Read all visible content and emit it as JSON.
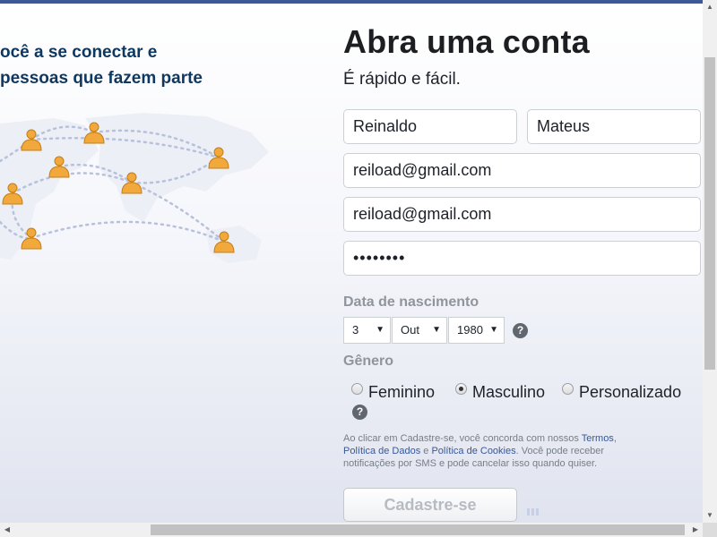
{
  "left": {
    "tagline_line1": "ocê a se conectar e",
    "tagline_line2": "pessoas que fazem parte"
  },
  "form": {
    "title": "Abra uma conta",
    "subtitle": "É rápido e fácil.",
    "first_name": "Reinaldo",
    "last_name": "Mateus",
    "email": "reiload@gmail.com",
    "email_confirm": "reiload@gmail.com",
    "password": "••••••••",
    "birth_label": "Data de nascimento",
    "birth_day": "3",
    "birth_month": "Out",
    "birth_year": "1980",
    "help_glyph": "?",
    "gender_label": "Gênero",
    "gender_options": [
      "Feminino",
      "Masculino",
      "Personalizado"
    ],
    "selected_gender": "Masculino",
    "terms": {
      "t1": "Ao clicar em Cadastre-se, você concorda com nossos ",
      "link_terms": "Termos",
      "t2": ", ",
      "link_data": "Política de Dados",
      "t3": " e ",
      "link_cookies": "Política de Cookies",
      "t4": ". Você pode receber notificações por SMS e pode cancelar isso quando quiser."
    },
    "signup_label": "Cadastre-se"
  },
  "icons": {
    "select_arrow": "dropdown-arrow-icon",
    "help": "question-mark-icon",
    "person": "person-icon"
  },
  "colors": {
    "brand_bar": "#3b5998",
    "tagline": "#0e385f",
    "link": "#365899",
    "person_icon": "#f2a93b"
  }
}
